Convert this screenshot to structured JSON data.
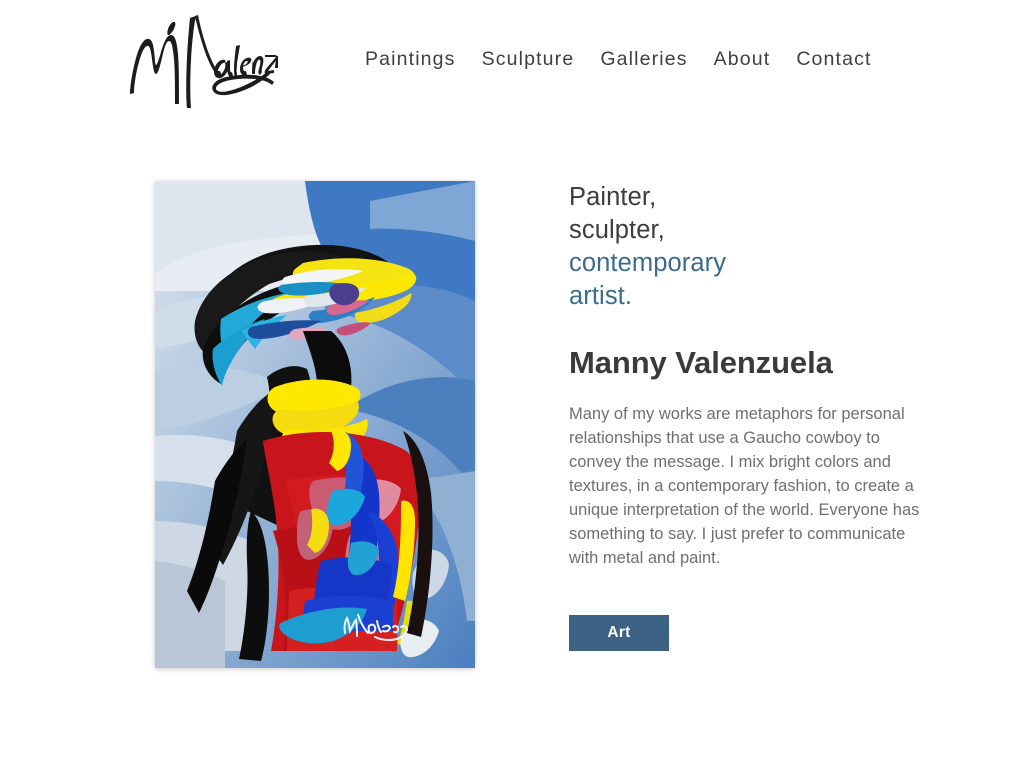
{
  "site": {
    "background_color": "#ffffff",
    "accent_color": "#3c6b8e",
    "button_color": "#3b6283",
    "heading_color": "#3a3a3a",
    "body_text_color": "#6f6f6f"
  },
  "header": {
    "logo": {
      "name": "m-valenzuela-signature-logo",
      "alt_text": "M Valenzuela",
      "color": "#1c1c1c"
    },
    "nav": [
      {
        "label": "Paintings",
        "name": "nav-item-paintings"
      },
      {
        "label": "Sculpture",
        "name": "nav-item-sculpture"
      },
      {
        "label": "Galleries",
        "name": "nav-item-galleries"
      },
      {
        "label": "About",
        "name": "nav-item-about"
      },
      {
        "label": "Contact",
        "name": "nav-item-contact"
      }
    ]
  },
  "hero": {
    "artwork": {
      "alt_text": "Abstract expressionist palette-knife painting of a gaucho figure in blue, yellow, red, black and white",
      "signature": "M Valenzuela"
    },
    "tagline": {
      "line1": "Painter,",
      "line2": "sculpter,",
      "line3": "contemporary",
      "line4": "artist."
    },
    "artist_name": "Manny Valenzuela",
    "bio": "Many of my works are metaphors for personal relationships that use a Gaucho cowboy to convey the message. I mix bright colors and textures, in a contemporary fashion, to create a unique interpretation of the world. Everyone has something to say. I just prefer to communicate with metal and paint.",
    "cta_label": "Art"
  }
}
